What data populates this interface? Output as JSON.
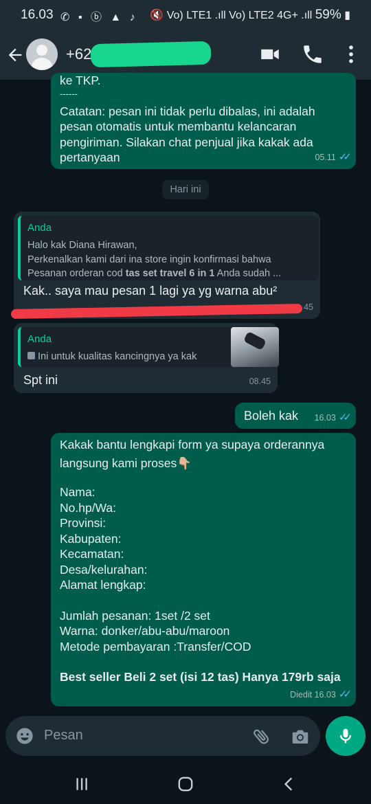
{
  "status_bar": {
    "time": "16.03",
    "notification_icons": "✆ ▪ ⓑ ▲ ♪",
    "signal_text": "🔇 Vo) LTE1 .ıll Vo) LTE2 4G+ .ıll",
    "battery": "59%"
  },
  "header": {
    "contact_name": "+62"
  },
  "messages": {
    "m1": {
      "top_text": "ke TKP.",
      "separator": "------",
      "body": "Catatan: pesan ini tidak perlu dibalas, ini adalah pesan otomatis untuk membantu kelancaran pengiriman. Silakan chat penjual jika kakak ada pertanyaan",
      "time": "05.11"
    },
    "date_chip": "Hari ini",
    "m2": {
      "quote_name": "Anda",
      "quote_line1": "Halo kak Diana Hirawan,",
      "quote_line2": "Perkenalkan kami dari ina store ingin konfirmasi bahwa",
      "quote_line3_pre": "Pesanan orderan cod ",
      "quote_line3_bold": "tas set travel 6 in 1",
      "quote_line3_post": " Anda sudah ...",
      "text": "Kak.. saya mau pesan 1 lagi ya yg warna abu²",
      "time": "45"
    },
    "m3": {
      "quote_name": "Anda",
      "quote_text": "Ini untuk kualitas kancingnya ya kak",
      "text": "Spt ini",
      "time": "08.45"
    },
    "m4": {
      "text": "Boleh kak",
      "time": "16.03"
    },
    "m5": {
      "line1": "Kakak bantu lengkapi form ya supaya orderannya",
      "line2": "langsung kami proses👇🏼",
      "form": [
        "Nama:",
        "No.hp/Wa:",
        "Provinsi:",
        "Kabupaten:",
        "Kecamatan:",
        "Desa/kelurahan:",
        "Alamat lengkap:"
      ],
      "order": [
        "Jumlah pesanan: 1set /2 set",
        "Warna:  donker/abu-abu/maroon",
        "Metode pembayaran :Transfer/COD"
      ],
      "promo": "Best seller Beli 2 set (isi 12 tas) Hanya 179rb saja",
      "edited": "Diedit",
      "time": "16.03"
    }
  },
  "input": {
    "placeholder": "Pesan"
  },
  "colors": {
    "app_bar": "#1f2c34",
    "outgoing": "#005c4b",
    "incoming": "#202c33",
    "accent": "#00a884",
    "read_tick": "#53bdeb",
    "redact_green": "#19d68f",
    "underline_red": "#f03b46"
  }
}
